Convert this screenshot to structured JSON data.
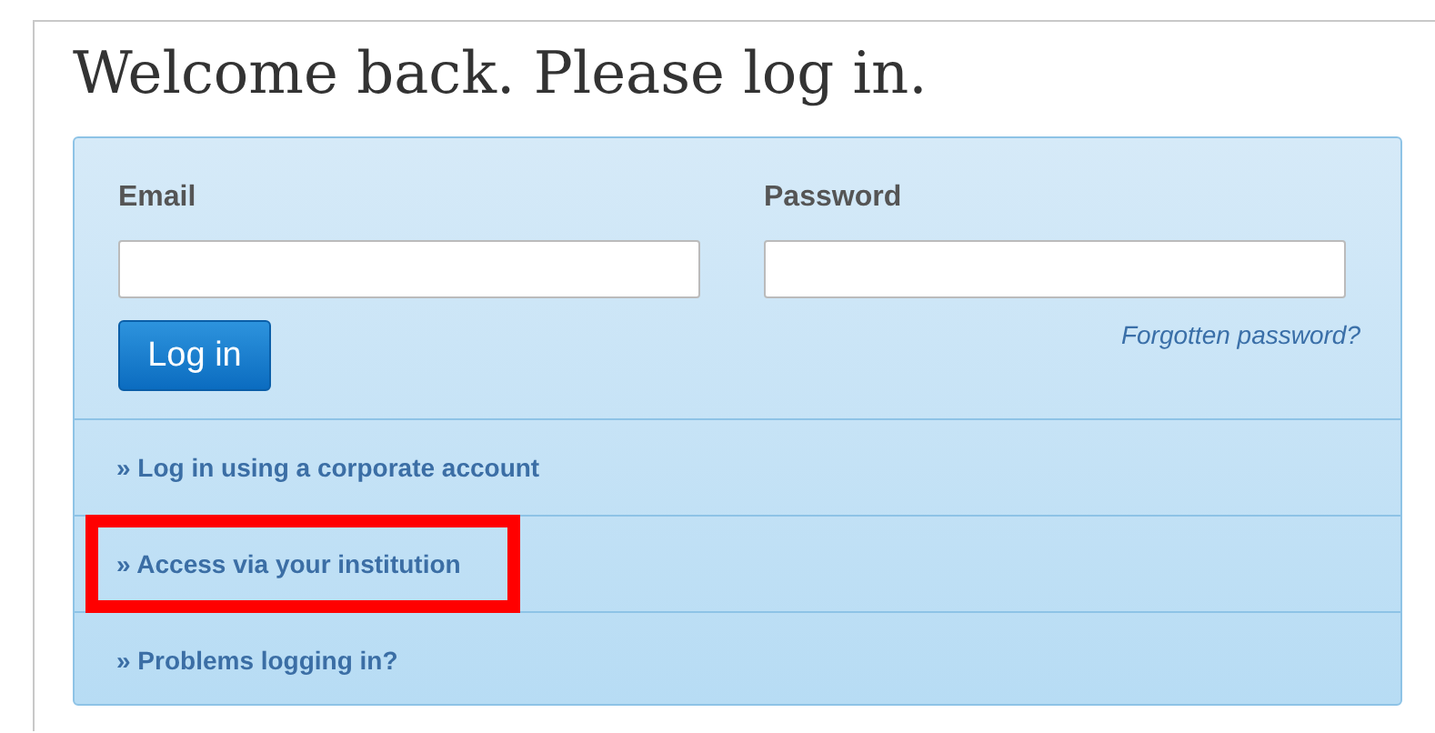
{
  "heading": "Welcome back. Please log in.",
  "form": {
    "email_label": "Email",
    "password_label": "Password",
    "login_button": "Log in",
    "forgot_link": "Forgotten password?"
  },
  "links": [
    {
      "label": "» Log in using a corporate account",
      "highlighted": false
    },
    {
      "label": "» Access via your institution",
      "highlighted": true
    },
    {
      "label": "» Problems logging in?",
      "highlighted": false
    }
  ]
}
